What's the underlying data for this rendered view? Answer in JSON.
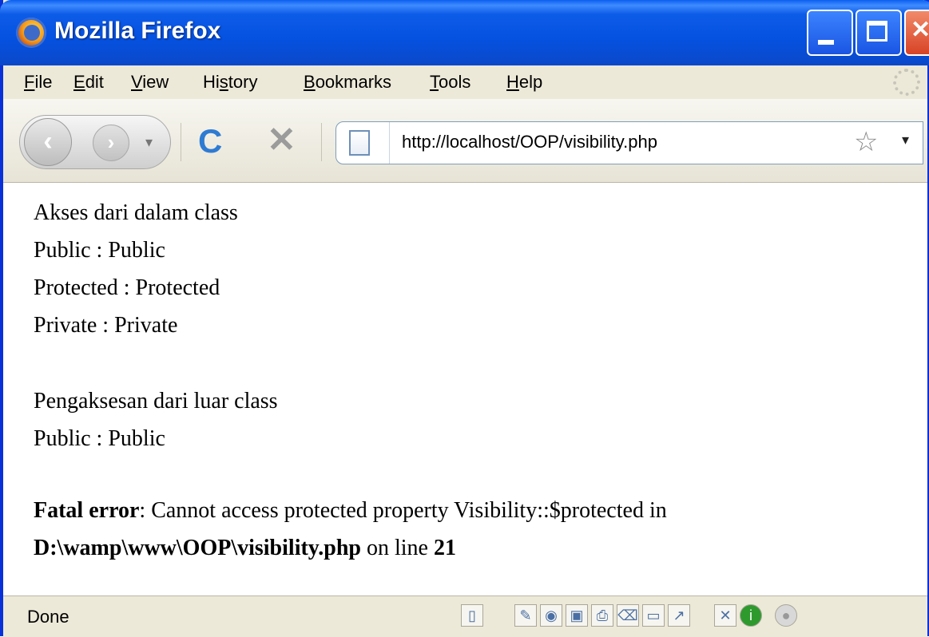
{
  "window": {
    "title": "Mozilla Firefox"
  },
  "menu": {
    "items": [
      {
        "label": "File",
        "access": "F",
        "rest": "ile"
      },
      {
        "label": "Edit",
        "access": "E",
        "rest": "dit"
      },
      {
        "label": "View",
        "access": "V",
        "rest": "iew"
      },
      {
        "label": "History",
        "pre": "Hi",
        "access": "s",
        "rest": "tory"
      },
      {
        "label": "Bookmarks",
        "access": "B",
        "rest": "ookmarks"
      },
      {
        "label": "Tools",
        "access": "T",
        "rest": "ools"
      },
      {
        "label": "Help",
        "access": "H",
        "rest": "elp"
      }
    ]
  },
  "nav": {
    "url": "http://localhost/OOP/visibility.php",
    "back_glyph": "‹",
    "forward_glyph": "›",
    "reload_glyph": "C",
    "stop_glyph": "✕",
    "star_glyph": "☆",
    "dropdown_glyph": "▾"
  },
  "content": {
    "lines": [
      "Akses dari dalam class",
      "Public : Public",
      "Protected : Protected",
      "Private : Private",
      "Pengaksesan dari luar class",
      "Public : Public"
    ],
    "error": {
      "label": "Fatal error",
      "message": ": Cannot access protected property Visibility::$protected in",
      "path": "D:\\wamp\\www\\OOP\\visibility.php",
      "line_text": " on line ",
      "line_number": "21"
    }
  },
  "status": {
    "text": "Done"
  },
  "colors": {
    "titlebar": "#0551e0",
    "chrome": "#ece9d8",
    "link_blue": "#2e7bd3"
  }
}
